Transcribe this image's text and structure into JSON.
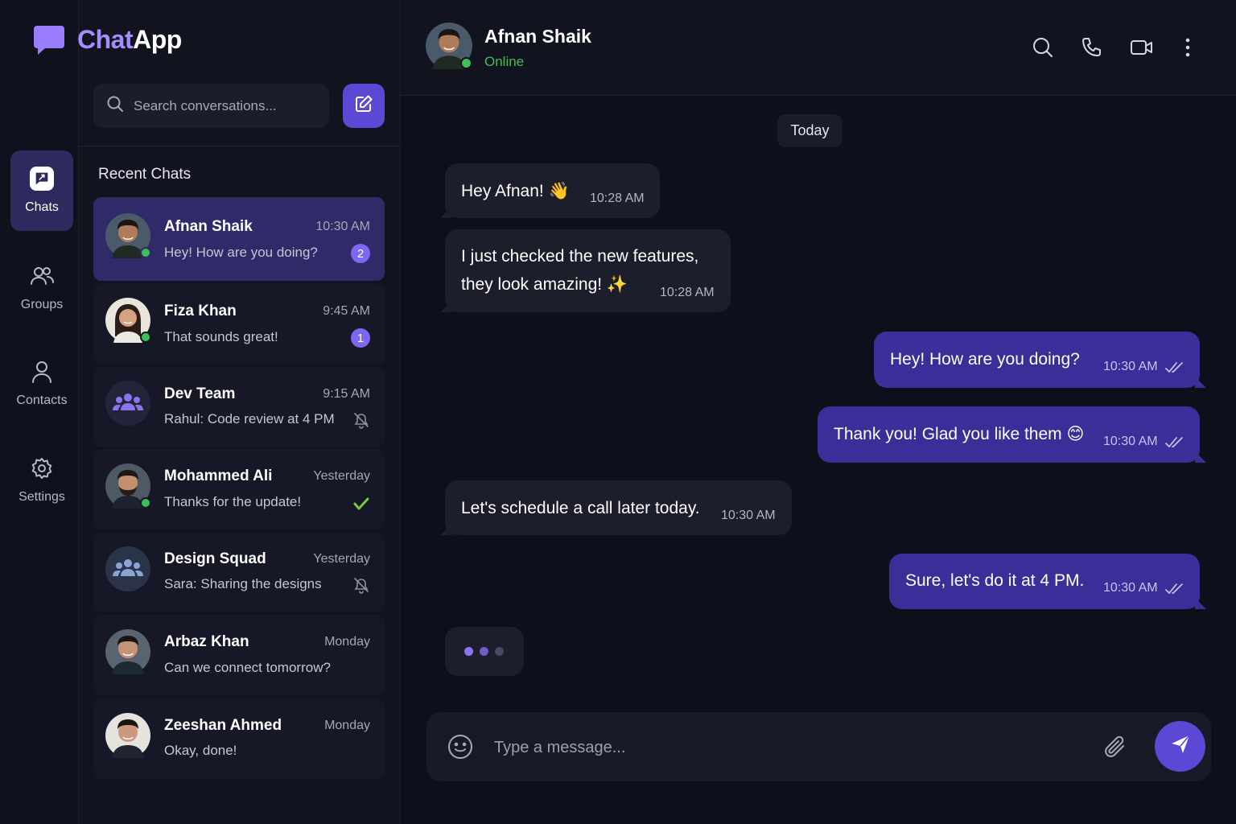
{
  "brand": {
    "name_part1": "Chat",
    "name_part2": "App",
    "accent": "#a58cff"
  },
  "nav": [
    {
      "label": "Chats",
      "icon": "chat-bubble-icon",
      "active": true
    },
    {
      "label": "Groups",
      "icon": "users-icon",
      "active": false
    },
    {
      "label": "Contacts",
      "icon": "user-icon",
      "active": false
    },
    {
      "label": "Settings",
      "icon": "gear-icon",
      "active": false
    }
  ],
  "search": {
    "placeholder": "Search conversations..."
  },
  "section_title": "Recent Chats",
  "chats": [
    {
      "name": "Afnan Shaik",
      "time": "10:30 AM",
      "preview": "Hey! How are you doing?",
      "unread": "2",
      "online": true,
      "status_icon": "unread-badge"
    },
    {
      "name": "Fiza Khan",
      "time": "9:45 AM",
      "preview": "That sounds great!",
      "unread": "1",
      "online": true,
      "status_icon": "unread-badge"
    },
    {
      "name": "Dev Team",
      "time": "9:15 AM",
      "preview": "Rahul: Code review at 4 PM",
      "unread": "",
      "online": false,
      "status_icon": "muted-bell-icon"
    },
    {
      "name": "Mohammed Ali",
      "time": "Yesterday",
      "preview": "Thanks for the update!",
      "unread": "",
      "online": true,
      "status_icon": "check-icon"
    },
    {
      "name": "Design Squad",
      "time": "Yesterday",
      "preview": "Sara: Sharing the designs",
      "unread": "",
      "online": false,
      "status_icon": "muted-bell-icon"
    },
    {
      "name": "Arbaz Khan",
      "time": "Monday",
      "preview": "Can we connect tomorrow?",
      "unread": "",
      "online": false,
      "status_icon": ""
    },
    {
      "name": "Zeeshan Ahmed",
      "time": "Monday",
      "preview": "Okay, done!",
      "unread": "",
      "online": false,
      "status_icon": ""
    }
  ],
  "conversation": {
    "name": "Afnan Shaik",
    "status": "Online",
    "day_label": "Today",
    "messages": [
      {
        "dir": "in",
        "text": "Hey Afnan! 👋",
        "time": "10:28 AM"
      },
      {
        "dir": "in",
        "text_line1": "I just checked the new features,",
        "text_line2": "they look amazing! ✨",
        "time": "10:28 AM"
      },
      {
        "dir": "out",
        "text": "Hey! How are you doing?",
        "time": "10:30 AM",
        "read": true
      },
      {
        "dir": "out",
        "text": "Thank you! Glad you like them 😊",
        "time": "10:30 AM",
        "read": true
      },
      {
        "dir": "in",
        "text": "Let's schedule a call later today.",
        "time": "10:30 AM"
      },
      {
        "dir": "out",
        "text": "Sure, let's do it at 4 PM.",
        "time": "10:30 AM",
        "read": true
      }
    ],
    "typing_indicator": true
  },
  "composer": {
    "placeholder": "Type a message..."
  },
  "colors": {
    "accent": "#5b49d6",
    "outgoing_bubble": "#3a2f99",
    "incoming_bubble": "#1c1e2c",
    "online": "#3fbf58",
    "badge": "#7e67f2"
  }
}
